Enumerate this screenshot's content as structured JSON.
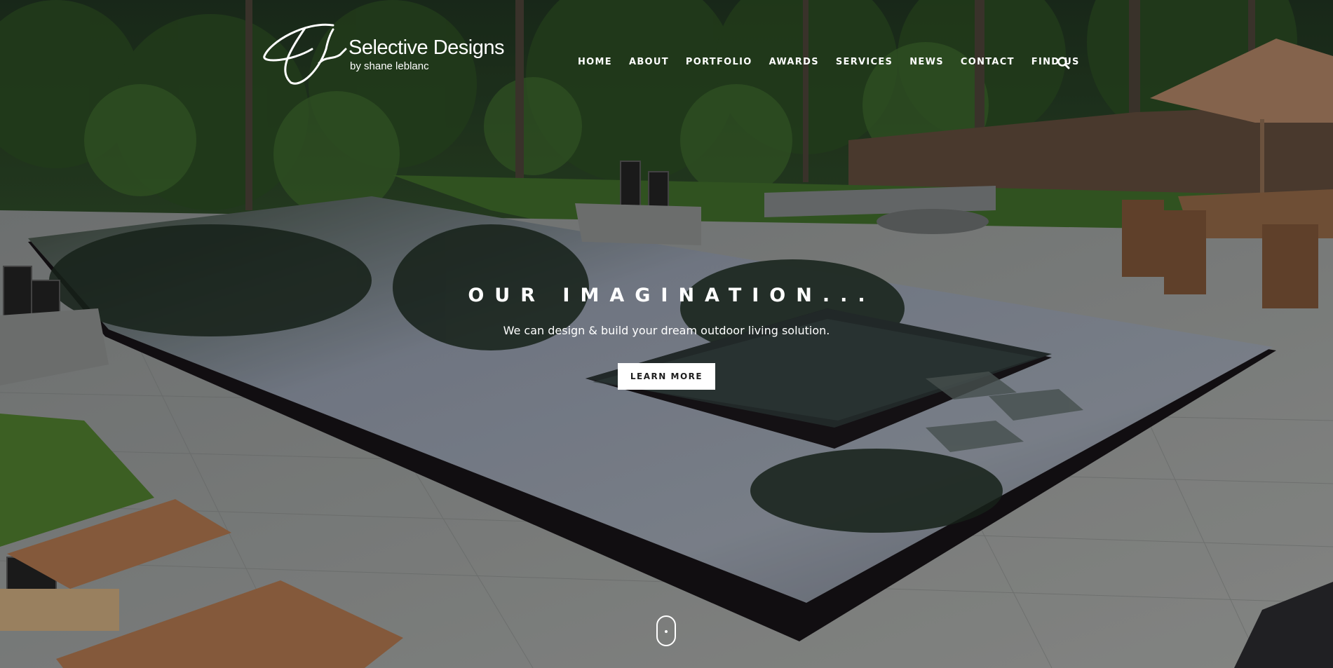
{
  "brand": {
    "name": "Selective Designs",
    "tagline": "by shane leblanc"
  },
  "nav": {
    "items": [
      {
        "label": "HOME"
      },
      {
        "label": "ABOUT"
      },
      {
        "label": "PORTFOLIO"
      },
      {
        "label": "AWARDS"
      },
      {
        "label": "SERVICES"
      },
      {
        "label": "NEWS"
      },
      {
        "label": "CONTACT"
      },
      {
        "label": "FIND US"
      }
    ],
    "search_icon": "search-icon"
  },
  "hero": {
    "headline": "OUR IMAGINATION...",
    "subline": "We can design & build your dream outdoor living solution.",
    "cta_label": "LEARN MORE",
    "background": "infinity-edge pool with stone patio, lawn, fire pit and wooden dining set"
  },
  "colors": {
    "text": "#ffffff",
    "button_bg": "#ffffff",
    "button_text": "#1e1e1e"
  }
}
